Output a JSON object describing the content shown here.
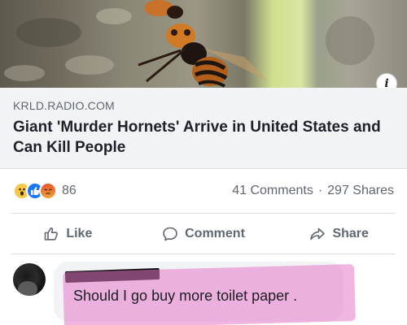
{
  "article": {
    "domain": "KRLD.RADIO.COM",
    "headline": "Giant 'Murder Hornets' Arrive in United States and Can Kill People",
    "info_icon": "info-icon"
  },
  "stats": {
    "reaction_count": "86",
    "reaction_icons": [
      "wow-reaction-icon",
      "like-reaction-icon",
      "angry-reaction-icon"
    ],
    "comments": "41 Comments",
    "separator": "·",
    "shares": "297 Shares"
  },
  "actions": {
    "like_label": "Like",
    "comment_label": "Comment",
    "share_label": "Share"
  },
  "comment": {
    "text": "Should I go buy more toilet paper ."
  },
  "colors": {
    "facebook_blue": "#1877f2",
    "text_secondary": "#606770",
    "highlight": "#e678c8"
  }
}
